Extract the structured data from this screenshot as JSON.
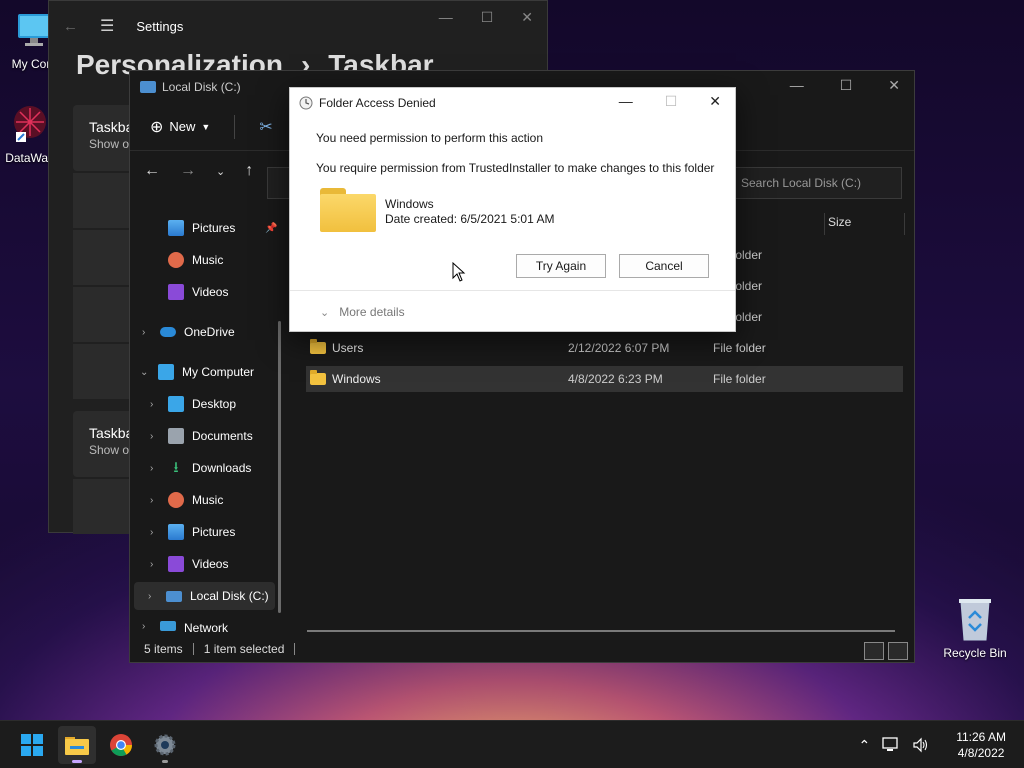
{
  "desktop": {
    "icons": [
      {
        "label": "My Com"
      },
      {
        "label": "DataWag"
      }
    ],
    "recycle_bin": "Recycle Bin"
  },
  "settings": {
    "title": "Settings",
    "breadcrumb_parent": "Personalization",
    "breadcrumb_sep": "›",
    "breadcrumb_current": "Taskbar",
    "card1": {
      "title": "Taskba",
      "subtitle": "Show o"
    },
    "card2": {
      "title": "Taskba",
      "subtitle": "Show o"
    }
  },
  "explorer": {
    "title": "Local Disk (C:)",
    "toolbar": {
      "new_label": "New"
    },
    "search_placeholder": "Search Local Disk (C:)",
    "column_size": "Size",
    "nav": [
      {
        "label": "Pictures",
        "icon": "pictures-icon",
        "pinned": true
      },
      {
        "label": "Music",
        "icon": "music-icon"
      },
      {
        "label": "Videos",
        "icon": "videos-icon"
      },
      {
        "label": "OneDrive",
        "icon": "onedrive-icon"
      },
      {
        "label": "My Computer",
        "icon": "computer-icon"
      },
      {
        "label": "Desktop",
        "icon": "desktop-icon"
      },
      {
        "label": "Documents",
        "icon": "documents-icon"
      },
      {
        "label": "Downloads",
        "icon": "downloads-icon"
      },
      {
        "label": "Music",
        "icon": "music-icon"
      },
      {
        "label": "Pictures",
        "icon": "pictures-icon"
      },
      {
        "label": "Videos",
        "icon": "videos-icon"
      },
      {
        "label": "Local Disk (C:)",
        "icon": "drive-icon"
      },
      {
        "label": "Network",
        "icon": "network-icon"
      }
    ],
    "partial_types": [
      "folder",
      "folder",
      "folder"
    ],
    "files": [
      {
        "name": "Users",
        "date": "2/12/2022 6:07 PM",
        "type": "File folder"
      },
      {
        "name": "Windows",
        "date": "4/8/2022 6:23 PM",
        "type": "File folder"
      }
    ],
    "status": {
      "items": "5 items",
      "selected": "1 item selected"
    }
  },
  "dialog": {
    "title": "Folder Access Denied",
    "message1": "You need permission to perform this action",
    "message2": "You require permission from TrustedInstaller to make changes to this folder",
    "folder_name": "Windows",
    "folder_date": "Date created: 6/5/2021 5:01 AM",
    "try_again": "Try Again",
    "cancel": "Cancel",
    "more_details": "More details"
  },
  "taskbar": {
    "time": "11:26 AM",
    "date": "4/8/2022"
  },
  "colors": {
    "accent": "#0078d4",
    "folder": "#f3c23f"
  }
}
